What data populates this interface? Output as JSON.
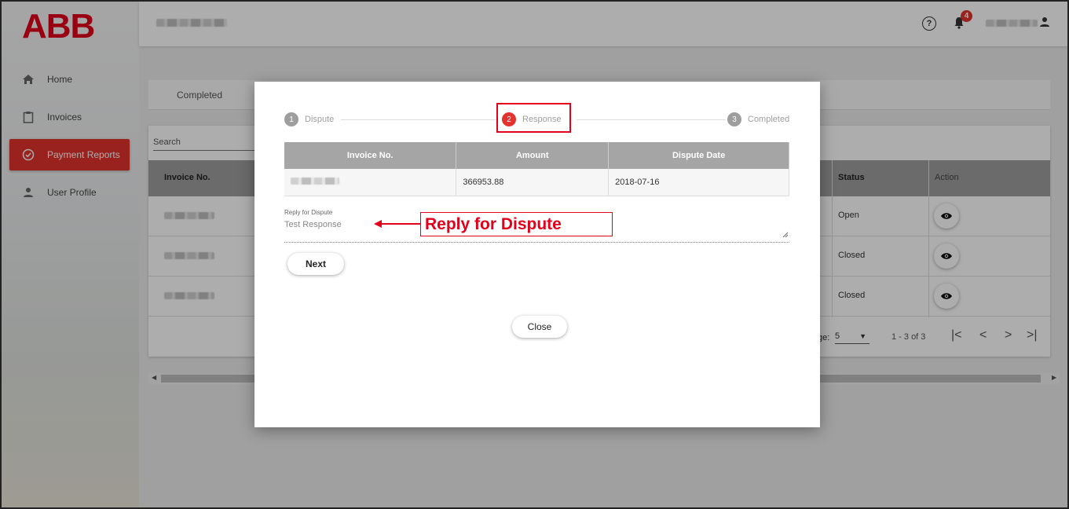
{
  "brand": {
    "logo_text": "ABB",
    "accent": "#e2332f"
  },
  "sidebar": {
    "items": [
      {
        "label": "Home",
        "icon": "home-icon",
        "active": false
      },
      {
        "label": "Invoices",
        "icon": "clipboard-icon",
        "active": false
      },
      {
        "label": "Payment Reports",
        "icon": "check-circle-icon",
        "active": true
      },
      {
        "label": "User Profile",
        "icon": "person-icon",
        "active": false
      }
    ]
  },
  "header": {
    "help_label": "?",
    "notification_count": "4"
  },
  "background": {
    "tab_label": "Completed",
    "search_label": "Search",
    "table": {
      "headers": {
        "invoice": "Invoice No.",
        "status": "Status",
        "action": "Action"
      },
      "rows": [
        {
          "status": "Open"
        },
        {
          "status": "Closed"
        },
        {
          "status": "Closed"
        }
      ]
    },
    "pagination": {
      "rows_label": "ge:",
      "rows_value": "5",
      "range": "1 - 3 of 3",
      "first": "|<",
      "prev": "<",
      "next": ">",
      "last": ">|"
    }
  },
  "modal": {
    "steps": [
      {
        "num": "1",
        "label": "Dispute",
        "active": false
      },
      {
        "num": "2",
        "label": "Response",
        "active": true
      },
      {
        "num": "3",
        "label": "Completed",
        "active": false
      }
    ],
    "table": {
      "headers": [
        "Invoice No.",
        "Amount",
        "Dispute Date"
      ],
      "row": {
        "amount": "366953.88",
        "dispute_date": "2018-07-16"
      }
    },
    "reply": {
      "label": "Reply for Dispute",
      "value": "Test Response"
    },
    "annotation": "Reply for Dispute",
    "next_label": "Next",
    "close_label": "Close"
  }
}
